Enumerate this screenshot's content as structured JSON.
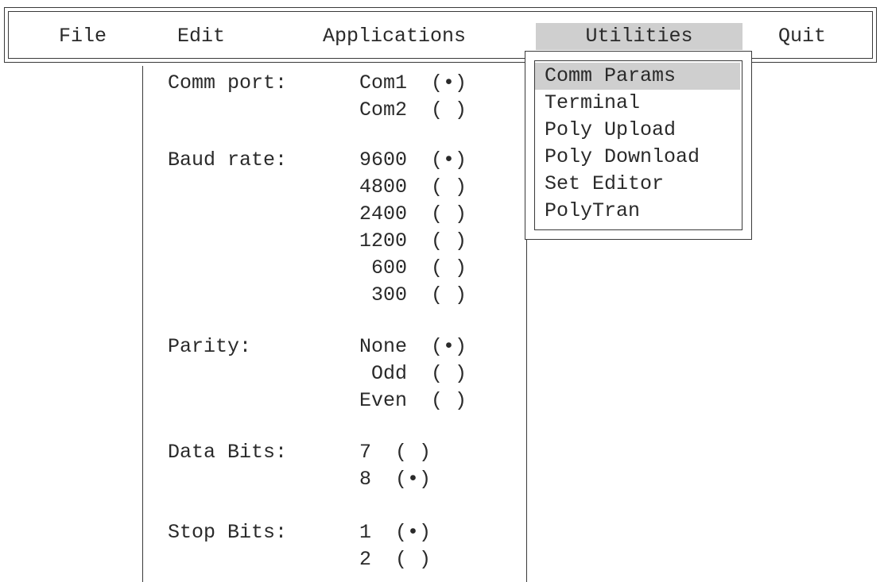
{
  "menubar": {
    "items": [
      {
        "label": "File"
      },
      {
        "label": "Edit"
      },
      {
        "label": "Applications"
      },
      {
        "label": "Utilities",
        "active": true
      },
      {
        "label": "Quit"
      }
    ]
  },
  "dropdown": {
    "items": [
      {
        "label": "Comm Params",
        "selected": true
      },
      {
        "label": "Terminal"
      },
      {
        "label": "Poly Upload"
      },
      {
        "label": "Poly Download"
      },
      {
        "label": "Set Editor"
      },
      {
        "label": "PolyTran"
      }
    ]
  },
  "comm": {
    "comm_port": {
      "label": "Comm port:",
      "options": [
        {
          "text": "Com1  (•)"
        },
        {
          "text": "Com2  ( )"
        }
      ]
    },
    "baud_rate": {
      "label": "Baud rate:",
      "options": [
        {
          "text": "9600  (•)"
        },
        {
          "text": "4800  ( )"
        },
        {
          "text": "2400  ( )"
        },
        {
          "text": "1200  ( )"
        },
        {
          "text": " 600  ( )"
        },
        {
          "text": " 300  ( )"
        }
      ]
    },
    "parity": {
      "label": "Parity:",
      "options": [
        {
          "text": "None  (•)"
        },
        {
          "text": " Odd  ( )"
        },
        {
          "text": "Even  ( )"
        }
      ]
    },
    "data_bits": {
      "label": "Data Bits:",
      "options": [
        {
          "text": "7  ( )"
        },
        {
          "text": "8  (•)"
        }
      ]
    },
    "stop_bits": {
      "label": "Stop Bits:",
      "options": [
        {
          "text": "1  (•)"
        },
        {
          "text": "2  ( )"
        }
      ]
    }
  },
  "colors": {
    "highlight": "#cfcfcf",
    "border": "#3a3a3a",
    "text": "#2a2a2a"
  }
}
